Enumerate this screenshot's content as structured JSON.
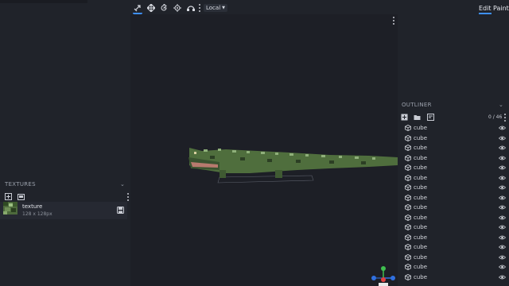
{
  "titlebar": {
    "tab_label": ""
  },
  "toolbar": {
    "tools": [
      {
        "name": "select-move-tool",
        "icon": "cursor-move-icon"
      },
      {
        "name": "move-tool",
        "icon": "move-arrows-icon"
      },
      {
        "name": "rotate-tool",
        "icon": "rotate-icon"
      },
      {
        "name": "pivot-tool",
        "icon": "crosshair-icon"
      },
      {
        "name": "vertex-snap-tool",
        "icon": "vertex-snap-icon"
      }
    ],
    "transform_space": "Local"
  },
  "modes": {
    "edit": "Edit",
    "paint": "Paint"
  },
  "textures": {
    "header": "TEXTURES",
    "items": [
      {
        "name": "texture",
        "size": "128 x 128px"
      }
    ]
  },
  "outliner": {
    "header": "OUTLINER",
    "count": "0 / 46",
    "items": [
      "cube",
      "cube",
      "cube",
      "cube",
      "cube",
      "cube",
      "cube",
      "cube",
      "cube",
      "cube",
      "cube",
      "cube",
      "cube",
      "cube",
      "cube",
      "cube"
    ]
  },
  "colors": {
    "accent": "#3e90ff",
    "model_green": "#4f6e3d",
    "model_highlight": "#8fb07a",
    "gizmo_x": "#e04040",
    "gizmo_y": "#3fbf4f",
    "gizmo_z": "#3070e0"
  }
}
